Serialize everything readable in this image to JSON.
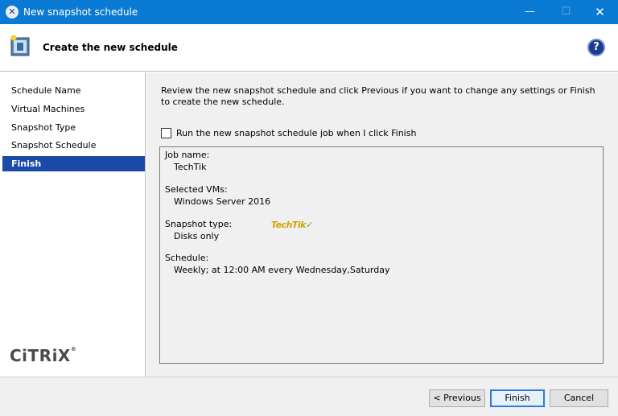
{
  "window": {
    "title": "New snapshot schedule",
    "min_glyph": "—",
    "max_glyph": "☐",
    "close_glyph": "✕"
  },
  "header": {
    "heading": "Create the new schedule",
    "help_glyph": "?"
  },
  "sidebar": {
    "items": [
      {
        "label": "Schedule Name",
        "active": false
      },
      {
        "label": "Virtual Machines",
        "active": false
      },
      {
        "label": "Snapshot Type",
        "active": false
      },
      {
        "label": "Snapshot Schedule",
        "active": false
      },
      {
        "label": "Finish",
        "active": true
      }
    ],
    "logo": "CiTRiX"
  },
  "main": {
    "intro": "Review the new snapshot schedule and click Previous if you want to change any settings or Finish to create the new schedule.",
    "run_checkbox": {
      "label": "Run the new snapshot schedule job when I click Finish",
      "checked": false
    },
    "summary": {
      "job_name_label": "Job name:",
      "job_name_value": "TechTik",
      "vms_label": "Selected VMs:",
      "vms_value": "Windows Server 2016",
      "type_label": "Snapshot type:",
      "type_value": "Disks only",
      "schedule_label": "Schedule:",
      "schedule_value": "Weekly; at 12:00 AM every Wednesday,Saturday"
    },
    "watermark": "TechTik"
  },
  "footer": {
    "previous_label": "< Previous",
    "finish_label": "Finish",
    "cancel_label": "Cancel"
  },
  "colors": {
    "titlebar": "#0a7ad4",
    "active_nav": "#1b4aa8",
    "help_icon": "#1e3a8a"
  },
  "icons": {
    "app": "xenserver-icon",
    "wizard": "schedule-wizard-icon",
    "help": "help-icon"
  }
}
